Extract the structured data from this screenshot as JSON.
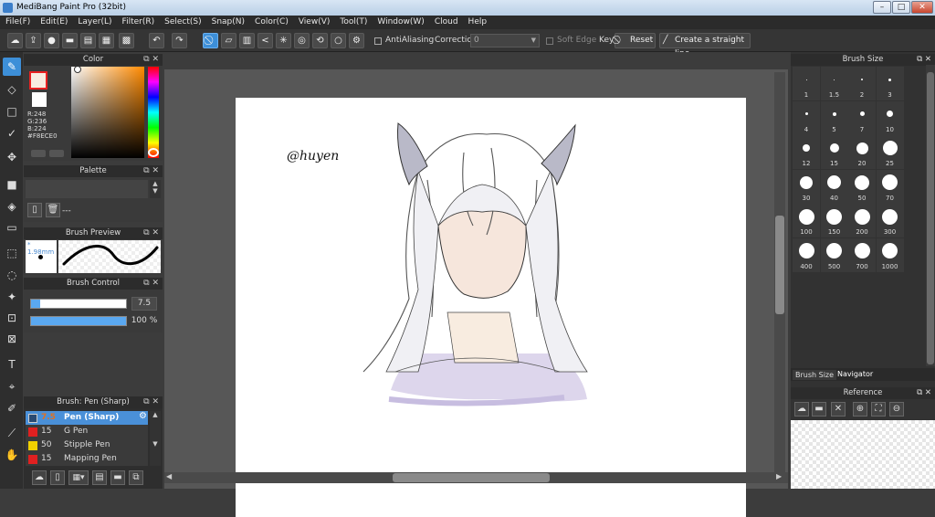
{
  "window": {
    "title": "MediBang Paint Pro (32bit)"
  },
  "menu": [
    "File(F)",
    "Edit(E)",
    "Layer(L)",
    "Filter(R)",
    "Select(S)",
    "Snap(N)",
    "Color(C)",
    "View(V)",
    "Tool(T)",
    "Window(W)",
    "Cloud",
    "Help"
  ],
  "toolbar": {
    "antialiasing": "AntiAliasing",
    "correction_label": "Correction",
    "correction_value": "0",
    "soft_edge": "Soft Edge",
    "key_label": "Key",
    "reset_label": "Reset",
    "straight_line_label": "Create a straight line"
  },
  "color_panel": {
    "title": "Color",
    "r": "R:248",
    "g": "G:236",
    "b": "B:224",
    "hex": "#F8ECE0",
    "primary_color": "#e82020",
    "secondary_color": "#ffffff"
  },
  "palette_panel": {
    "title": "Palette",
    "text": "---"
  },
  "brush_preview": {
    "title": "Brush Preview",
    "size": "* 1.98mm"
  },
  "brush_control": {
    "title": "Brush Control",
    "size_value": "7.5",
    "size_fill": 0.1,
    "opacity_value": "100 %",
    "opacity_fill": 1.0
  },
  "brush_list": {
    "title": "Brush: Pen (Sharp)",
    "items": [
      {
        "size": "7.5",
        "name": "Pen (Sharp)",
        "color": "#2a4a72"
      },
      {
        "size": "15",
        "name": "G Pen",
        "color": "#e02020"
      },
      {
        "size": "50",
        "name": "Stipple Pen",
        "color": "#f0d000"
      },
      {
        "size": "15",
        "name": "Mapping Pen",
        "color": "#e02020"
      }
    ]
  },
  "canvas": {
    "signature": "@huyen"
  },
  "brush_size_panel": {
    "title": "Brush Size",
    "sizes": [
      "1",
      "1.5",
      "2",
      "3",
      "4",
      "5",
      "7",
      "10",
      "12",
      "15",
      "20",
      "25",
      "30",
      "40",
      "50",
      "70",
      "100",
      "150",
      "200",
      "300",
      "400",
      "500",
      "700",
      "1000"
    ],
    "tabs": [
      "Brush Size",
      "Navigator"
    ]
  },
  "reference_panel": {
    "title": "Reference"
  }
}
